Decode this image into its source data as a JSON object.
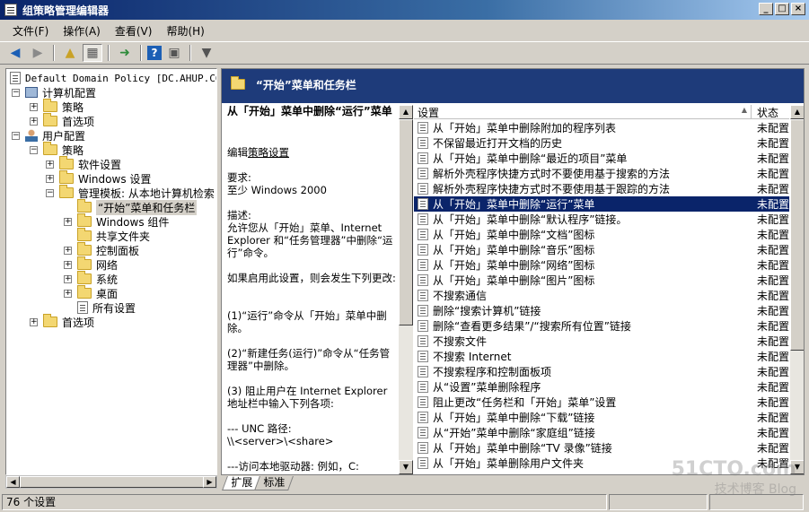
{
  "window": {
    "title": "组策略管理编辑器",
    "buttons": [
      "_",
      "□",
      "×"
    ]
  },
  "menu": [
    "文件(F)",
    "操作(A)",
    "查看(V)",
    "帮助(H)"
  ],
  "tree": {
    "root": "Default Domain Policy [DC.AHUP.COM]",
    "items": [
      {
        "label": "计算机配置",
        "expander": "−",
        "icon": "computer-icon"
      },
      {
        "label": "策略",
        "expander": "+",
        "icon": "folder-icon"
      },
      {
        "label": "首选项",
        "expander": "+",
        "icon": "folder-icon"
      },
      {
        "label": "用户配置",
        "expander": "−",
        "icon": "user-icon"
      },
      {
        "label": "策略",
        "expander": "−",
        "icon": "folder-icon"
      },
      {
        "label": "软件设置",
        "expander": "+",
        "icon": "folder-icon"
      },
      {
        "label": "Windows 设置",
        "expander": "+",
        "icon": "folder-icon"
      },
      {
        "label": "管理模板: 从本地计算机检索",
        "expander": "−",
        "icon": "folder-icon"
      },
      {
        "label": "“开始”菜单和任务栏",
        "expander": "",
        "icon": "folder-icon"
      },
      {
        "label": "Windows 组件",
        "expander": "+",
        "icon": "folder-icon"
      },
      {
        "label": "共享文件夹",
        "expander": "",
        "icon": "folder-icon"
      },
      {
        "label": "控制面板",
        "expander": "+",
        "icon": "folder-icon"
      },
      {
        "label": "网络",
        "expander": "+",
        "icon": "folder-icon"
      },
      {
        "label": "系统",
        "expander": "+",
        "icon": "folder-icon"
      },
      {
        "label": "桌面",
        "expander": "+",
        "icon": "folder-icon"
      },
      {
        "label": "所有设置",
        "expander": "",
        "icon": "settings-icon"
      },
      {
        "label": "首选项",
        "expander": "+",
        "icon": "folder-icon"
      }
    ]
  },
  "right_header": {
    "title": "“开始”菜单和任务栏"
  },
  "description": {
    "title": "从「开始」菜单中删除“运行”菜单",
    "edit_prefix": "编辑",
    "edit_link": "策略设置",
    "requirement_label": "要求:",
    "requirement_value": "至少 Windows 2000",
    "desc_label": "描述:",
    "desc_text": "允许您从「开始」菜单、Internet Explorer 和“任务管理器”中删除“运行”命令。",
    "enabled_text": "如果启用此设置，则会发生下列更改:",
    "change1": "(1)“运行”命令从「开始」菜单中删除。",
    "change2": "(2)“新建任务(运行)”命令从“任务管理器”中删除。",
    "change3": "(3) 阻止用户在 Internet Explorer 地址栏中输入下列各项:",
    "unc_label": "--- UNC 路径:",
    "unc_value": "\\\\<server>\\<share>",
    "local_drive": "---访问本地驱动器: 例如，C:"
  },
  "list": {
    "col_setting": "设置",
    "col_state": "状态",
    "rows": [
      {
        "name": "从「开始」菜单中删除附加的程序列表",
        "state": "未配置"
      },
      {
        "name": "不保留最近打开文档的历史",
        "state": "未配置"
      },
      {
        "name": "从「开始」菜单中删除“最近的项目”菜单",
        "state": "未配置"
      },
      {
        "name": "解析外壳程序快捷方式时不要使用基于搜索的方法",
        "state": "未配置"
      },
      {
        "name": "解析外壳程序快捷方式时不要使用基于跟踪的方法",
        "state": "未配置"
      },
      {
        "name": "从「开始」菜单中删除“运行”菜单",
        "state": "未配置",
        "selected": true
      },
      {
        "name": "从「开始」菜单中删除“默认程序”链接。",
        "state": "未配置"
      },
      {
        "name": "从「开始」菜单中删除“文档”图标",
        "state": "未配置"
      },
      {
        "name": "从「开始」菜单中删除“音乐”图标",
        "state": "未配置"
      },
      {
        "name": "从「开始」菜单中删除“网络”图标",
        "state": "未配置"
      },
      {
        "name": "从「开始」菜单中删除“图片”图标",
        "state": "未配置"
      },
      {
        "name": "不搜索通信",
        "state": "未配置"
      },
      {
        "name": "删除“搜索计算机”链接",
        "state": "未配置"
      },
      {
        "name": "删除“查看更多结果”/“搜索所有位置”链接",
        "state": "未配置"
      },
      {
        "name": "不搜索文件",
        "state": "未配置"
      },
      {
        "name": "不搜索 Internet",
        "state": "未配置"
      },
      {
        "name": "不搜索程序和控制面板项",
        "state": "未配置"
      },
      {
        "name": "从“设置”菜单删除程序",
        "state": "未配置"
      },
      {
        "name": "阻止更改“任务栏和「开始」菜单”设置",
        "state": "未配置"
      },
      {
        "name": "从「开始」菜单中删除“下载”链接",
        "state": "未配置"
      },
      {
        "name": "从“开始”菜单中删除“家庭组”链接",
        "state": "未配置"
      },
      {
        "name": "从「开始」菜单中删除“TV 录像”链接",
        "state": "未配置"
      },
      {
        "name": "从「开始」菜单删除用户文件夹",
        "state": "未配置"
      }
    ]
  },
  "tabs": [
    "扩展",
    "标准"
  ],
  "status": {
    "text": "76 个设置"
  },
  "watermark": {
    "main": "51CTO.com",
    "sub": "技术博客  Blog"
  }
}
